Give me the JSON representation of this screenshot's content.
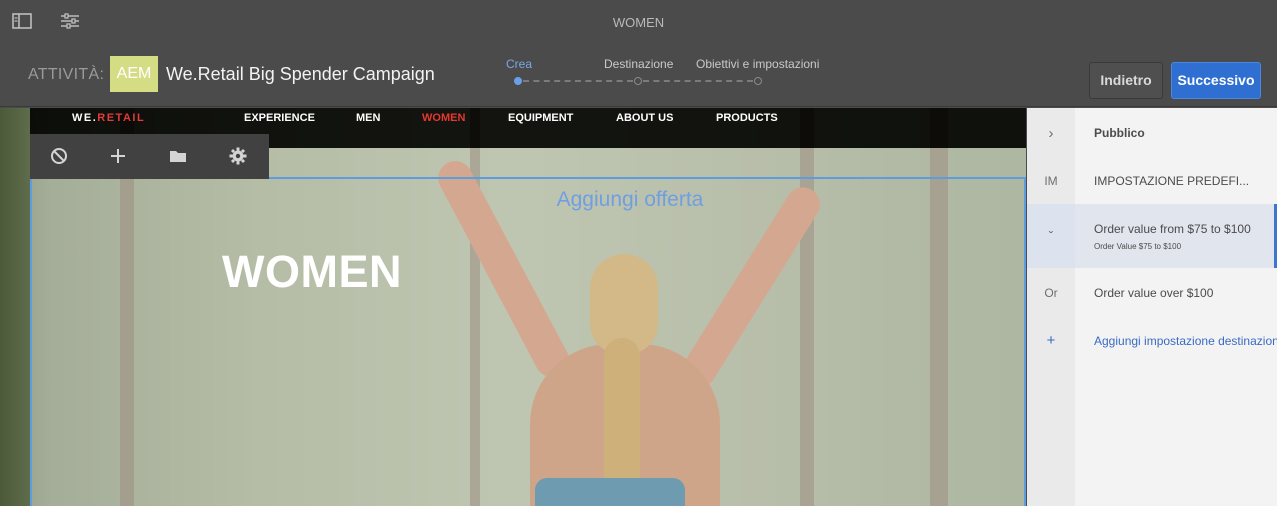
{
  "topbar": {
    "page_title": "WOMEN",
    "icons": [
      "sidebar-toggle-icon",
      "sliders-icon"
    ]
  },
  "header": {
    "activity_label": "ATTIVITÀ:",
    "badge": "AEM",
    "activity_name": "We.Retail Big Spender Campaign",
    "steps": [
      {
        "label": "Crea",
        "active": true
      },
      {
        "label": "Destinazione",
        "active": false
      },
      {
        "label": "Obiettivi e impostazioni",
        "active": false
      }
    ],
    "back_label": "Indietro",
    "next_label": "Successivo"
  },
  "site": {
    "logo_main": "WE.",
    "logo_accent": "RETAIL",
    "nav": [
      {
        "label": "EXPERIENCE",
        "active": false
      },
      {
        "label": "MEN",
        "active": false
      },
      {
        "label": "WOMEN",
        "active": true
      },
      {
        "label": "EQUIPMENT",
        "active": false
      },
      {
        "label": "ABOUT US",
        "active": false
      },
      {
        "label": "PRODUCTS",
        "active": false
      }
    ],
    "hero_title": "WOMEN",
    "add_offer": "Aggiungi offerta"
  },
  "component_toolbar": {
    "icons": [
      "block-icon",
      "plus-icon",
      "folder-icon",
      "gear-icon"
    ]
  },
  "panel": {
    "rows": [
      {
        "left": "›",
        "text": "Pubblico",
        "bold": true
      },
      {
        "left": "IM",
        "text": "IMPOSTAZIONE PREDEFI..."
      },
      {
        "left": "ˇ",
        "text": "Order value from $75 to $100",
        "sub": "Order Value $75 to $100",
        "selected": true
      },
      {
        "left": "Or",
        "text": "Order value over $100"
      },
      {
        "left": "+",
        "text": "Aggiungi impostazione destinazione"
      }
    ]
  },
  "colors": {
    "accent": "#2f6fd1",
    "badge": "#d5dd84",
    "nav_active": "#e8372f",
    "selection": "#5e9ce0"
  }
}
